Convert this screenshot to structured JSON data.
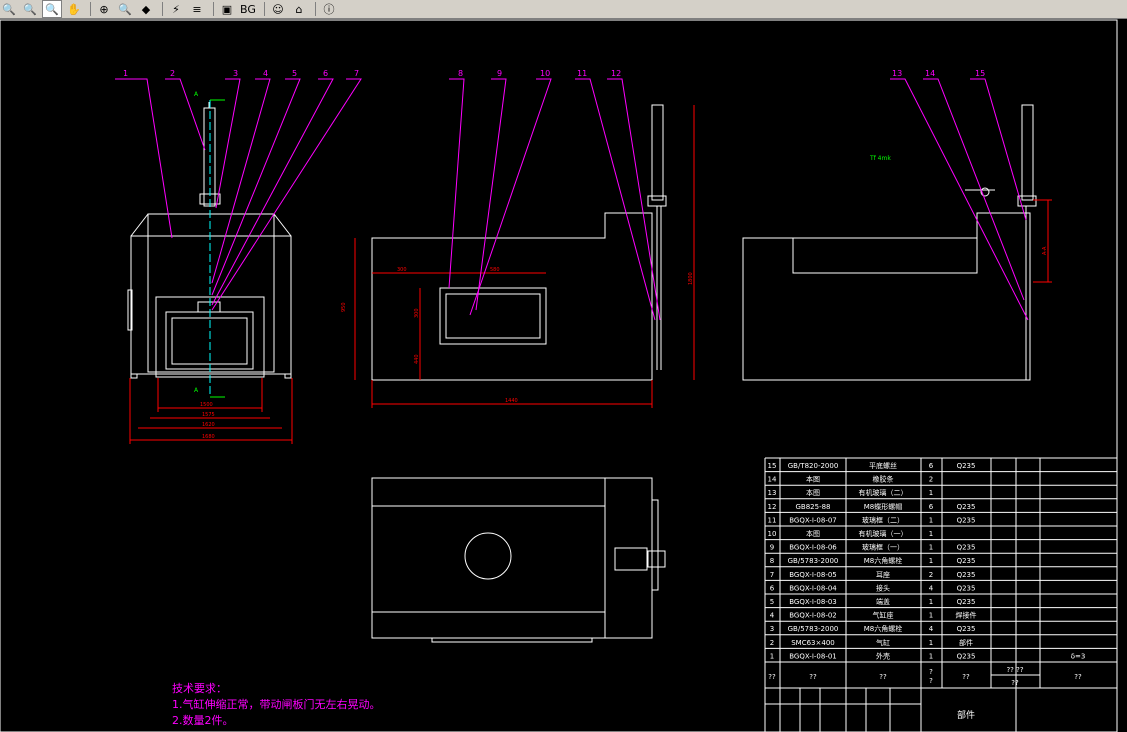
{
  "toolbar": {
    "icons": [
      "zoom-out-icon",
      "zoom-in-icon",
      "zoom-window-icon",
      "pan-icon",
      "zoom-realtime-icon",
      "zoom-extents-icon",
      "layer-icon",
      "lightning-icon",
      "layers-icon",
      "print-icon"
    ],
    "bg_label": "BG",
    "icons_right": [
      "user-icon",
      "home-icon",
      "info-icon"
    ]
  },
  "callouts": [
    "1",
    "2",
    "3",
    "4",
    "5",
    "6",
    "7",
    "8",
    "9",
    "10",
    "11",
    "12",
    "13",
    "14",
    "15"
  ],
  "dims": {
    "front_w1": "1500",
    "front_w2": "1575",
    "front_w3": "1620",
    "front_w4": "1680",
    "side_total": "1440",
    "side_left": "300",
    "side_win": "580",
    "side_h1": "950",
    "side_h2": "1800",
    "side_h3": "300",
    "side_h4": "440",
    "section_mark": "A",
    "right_dim": "A-A"
  },
  "note_label": "Tf 4mk",
  "tech": {
    "title": "技术要求：",
    "line1": "1.气缸伸缩正常，带动闸板门无左右晃动。",
    "line2": "2.数量2件。"
  },
  "bom": [
    {
      "no": "15",
      "code": "GB/T820-2000",
      "name": "平底螺丝",
      "qty": "6",
      "mat": "Q235"
    },
    {
      "no": "14",
      "code": "本图",
      "name": "橡胶条",
      "qty": "2",
      "mat": ""
    },
    {
      "no": "13",
      "code": "本图",
      "name": "有机玻璃（二）",
      "qty": "1",
      "mat": ""
    },
    {
      "no": "12",
      "code": "GB825-88",
      "name": "M8蝶形螺帽",
      "qty": "6",
      "mat": "Q235"
    },
    {
      "no": "11",
      "code": "BGQX-I-08-07",
      "name": "玻璃框（二）",
      "qty": "1",
      "mat": "Q235"
    },
    {
      "no": "10",
      "code": "本图",
      "name": "有机玻璃（一）",
      "qty": "1",
      "mat": ""
    },
    {
      "no": "9",
      "code": "BGQX-I-08-06",
      "name": "玻璃框（一）",
      "qty": "1",
      "mat": "Q235"
    },
    {
      "no": "8",
      "code": "GB/5783-2000",
      "name": "M8六角螺栓",
      "qty": "1",
      "mat": "Q235"
    },
    {
      "no": "7",
      "code": "BGQX-I-08-05",
      "name": "耳座",
      "qty": "2",
      "mat": "Q235"
    },
    {
      "no": "6",
      "code": "BGQX-I-08-04",
      "name": "接头",
      "qty": "4",
      "mat": "Q235"
    },
    {
      "no": "5",
      "code": "BGQX-I-08-03",
      "name": "端盖",
      "qty": "1",
      "mat": "Q235"
    },
    {
      "no": "4",
      "code": "BGQX-I-08-02",
      "name": "气缸座",
      "qty": "1",
      "mat": "焊接件"
    },
    {
      "no": "3",
      "code": "GB/5783-2000",
      "name": "M8六角螺栓",
      "qty": "4",
      "mat": "Q235"
    },
    {
      "no": "2",
      "code": "SMC63×400",
      "name": "气缸",
      "qty": "1",
      "mat": "部件"
    },
    {
      "no": "1",
      "code": "BGQX-I-08-01",
      "name": "外壳",
      "qty": "1",
      "mat": "Q235",
      "extra": "δ=3"
    }
  ],
  "bom_footer": {
    "q1": "??",
    "q2": "??",
    "q3": "??",
    "q4": "?\n?",
    "q5": "??",
    "q6": "?? ??",
    "q7": "??",
    "q8": "??"
  },
  "title_block": {
    "name": "部件"
  },
  "colors": {
    "bg": "#000000",
    "white": "#ffffff",
    "red": "#ff0000",
    "magenta": "#ff00ff",
    "green": "#00ff00",
    "cyan": "#00ffff"
  }
}
